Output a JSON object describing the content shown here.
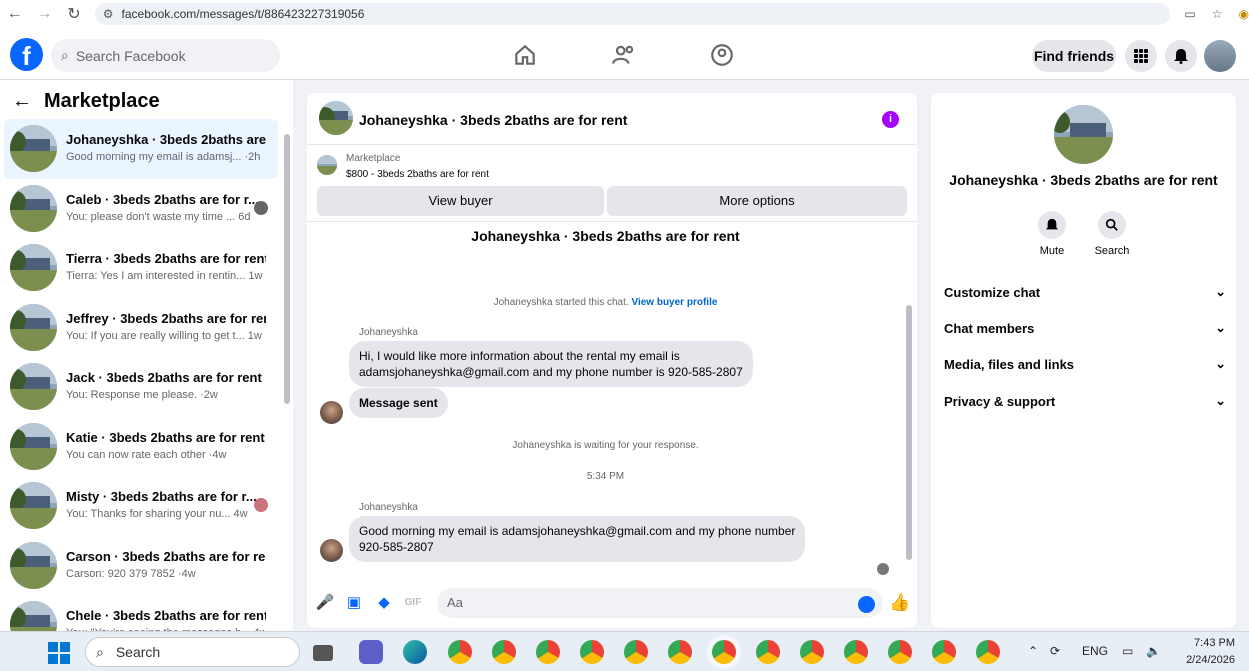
{
  "browser": {
    "url": "facebook.com/messages/t/886423227319056"
  },
  "topbar": {
    "search_placeholder": "Search Facebook",
    "find_friends": "Find friends"
  },
  "sidebar": {
    "title": "Marketplace",
    "conversations": [
      {
        "name": "Johaneyshka · 3beds 2baths are ...",
        "preview": "Good morning my email is adamsj... ·2h",
        "active": true
      },
      {
        "name": "Caleb · 3beds 2baths are for r...",
        "preview": "You: please don't waste my time ... 6d",
        "active": false
      },
      {
        "name": "Tierra · 3beds 2baths are for rent",
        "preview": "Tierra: Yes I am interested in rentin... 1w",
        "active": false
      },
      {
        "name": "Jeffrey · 3beds 2baths are for rent",
        "preview": "You: If you are really willing to get t... 1w",
        "active": false
      },
      {
        "name": "Jack · 3beds 2baths are for rent",
        "preview": "You: Response me please. ·2w",
        "active": false
      },
      {
        "name": "Katie · 3beds 2baths are for rent",
        "preview": "You can now rate each other ·4w",
        "active": false
      },
      {
        "name": "Misty · 3beds 2baths are for r...",
        "preview": "You: Thanks for sharing your nu...   4w",
        "active": false
      },
      {
        "name": "Carson · 3beds 2baths are for rent",
        "preview": "Carson: 920 379 7852 ·4w",
        "active": false
      },
      {
        "name": "Chele · 3beds 2baths are for rent",
        "preview": "You: \"You're seeing the messages b... 4w",
        "active": false
      }
    ]
  },
  "chat": {
    "title": "Johaneyshka · 3beds 2baths are for rent",
    "marketplace_label": "Marketplace",
    "listing": "$800 - 3beds 2baths are for rent",
    "view_buyer": "View buyer",
    "more_options": "More options",
    "thread_title": "Johaneyshka · 3beds 2baths are for rent",
    "started_text": "Johaneyshka started this chat.",
    "view_profile": "View buyer profile",
    "sender1": "Johaneyshka",
    "msg1_line1": "Hi, I would like more information about the rental my email is",
    "msg1_line2": "adamsjohaneyshka@gmail.com and my phone number is 920-585-2807",
    "msg2": "Message sent",
    "waiting": "Johaneyshka is waiting for your response.",
    "time": "5:34 PM",
    "sender2": "Johaneyshka",
    "msg3_line1": "Good morning my email is adamsjohaneyshka@gmail.com and my phone number",
    "msg3_line2": "920-585-2807",
    "input_placeholder": "Aa"
  },
  "rightpanel": {
    "name": "Johaneyshka · 3beds 2baths are for rent",
    "mute": "Mute",
    "search": "Search",
    "sections": [
      "Customize chat",
      "Chat members",
      "Media, files and links",
      "Privacy & support"
    ]
  },
  "taskbar": {
    "search": "Search",
    "lang": "ENG",
    "time": "7:43 PM",
    "date": "2/24/2026"
  },
  "colors": {
    "fb_blue": "#0866ff",
    "info_purple": "#a400ff",
    "active_row": "#ebf5ff"
  }
}
